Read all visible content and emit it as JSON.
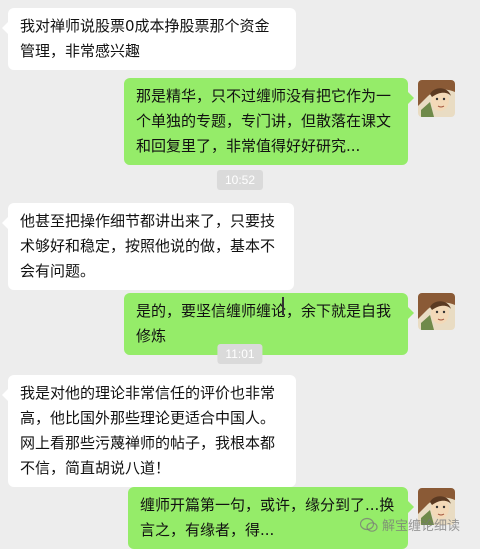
{
  "conversation": {
    "messages": [
      {
        "side": "left",
        "text": "我对禅师说股票0成本挣股票那个资金管理，非常感兴趣"
      },
      {
        "side": "right",
        "text": "那是精华，只不过缠师没有把它作为一个单独的专题，专门讲，但散落在课文和回复里了，非常值得好好研究..."
      },
      {
        "side": "left",
        "text": "他甚至把操作细节都讲出来了，只要技术够好和稳定，按照他说的做，基本不会有问题。"
      },
      {
        "side": "right",
        "text": "是的，要坚信缠师缠论，余下就是自我修炼"
      },
      {
        "side": "left",
        "text": "我是对他的理论非常信任的评价也非常高，他比国外那些理论更适合中国人。网上看那些污蔑禅师的帖子，我根本都不信，简直胡说八道！"
      },
      {
        "side": "right",
        "text": "缠师开篇第一句，或许，缘分到了...换言之，有缘者，得..."
      }
    ],
    "timestamps": [
      "10:52",
      "11:01"
    ]
  },
  "watermark": {
    "text": "解宝缠论细读",
    "icon": "chat-bubble-icon"
  },
  "colors": {
    "background": "#ededed",
    "left_bubble": "#ffffff",
    "right_bubble": "#95ec69",
    "timestamp_bg": "#dadada"
  }
}
